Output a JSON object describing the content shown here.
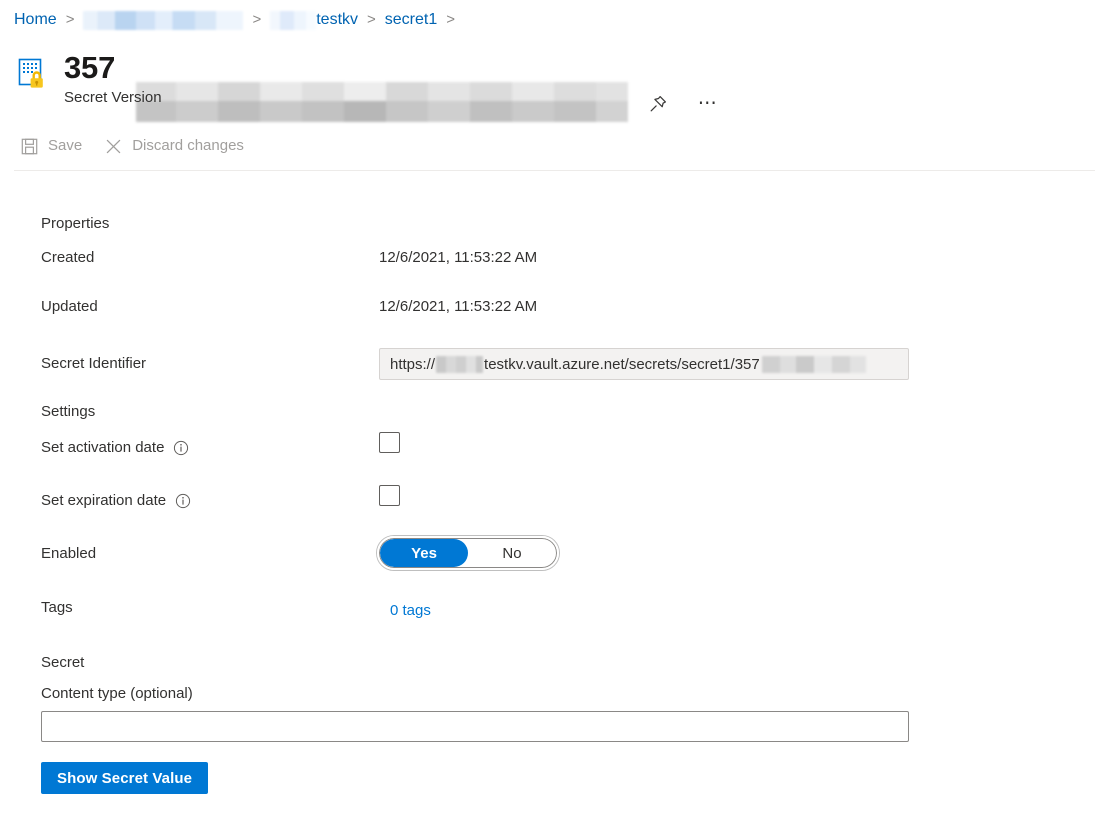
{
  "breadcrumb": {
    "home_label": "Home",
    "redacted_resource_group": "",
    "vault_label": "testkv",
    "secret_label": "secret1",
    "separator": ">"
  },
  "header": {
    "title_prefix": "357",
    "subtitle": "Secret Version",
    "icon": "key-vault-secret-icon",
    "pin_icon": "pin-icon",
    "more_icon": "ellipsis-icon"
  },
  "commandbar": {
    "save_label": "Save",
    "save_icon": "save-disk-icon",
    "discard_label": "Discard changes",
    "discard_icon": "close-x-icon"
  },
  "properties": {
    "section_title": "Properties",
    "created_label": "Created",
    "created_value": "12/6/2021, 11:53:22 AM",
    "updated_label": "Updated",
    "updated_value": "12/6/2021, 11:53:22 AM",
    "secret_identifier_label": "Secret Identifier",
    "secret_identifier_prefix": "https://",
    "secret_identifier_middle": "testkv.vault.azure.net/secrets/secret1/357"
  },
  "settings": {
    "section_title": "Settings",
    "activation_label": "Set activation date",
    "activation_info_icon": "info-circle-icon",
    "activation_checked": false,
    "expiration_label": "Set expiration date",
    "expiration_info_icon": "info-circle-icon",
    "expiration_checked": false,
    "enabled_label": "Enabled",
    "enabled_yes": "Yes",
    "enabled_no": "No",
    "enabled_value": "Yes",
    "tags_label": "Tags",
    "tags_value": "0 tags"
  },
  "secret": {
    "section_title": "Secret",
    "content_type_label": "Content type (optional)",
    "content_type_value": "",
    "content_type_placeholder": "",
    "show_button_label": "Show Secret Value"
  },
  "colors": {
    "accent": "#0078d4",
    "link": "#0063b1",
    "disabled_text": "#a19f9d",
    "text": "#323130",
    "readonly_bg": "#f3f2f1"
  }
}
